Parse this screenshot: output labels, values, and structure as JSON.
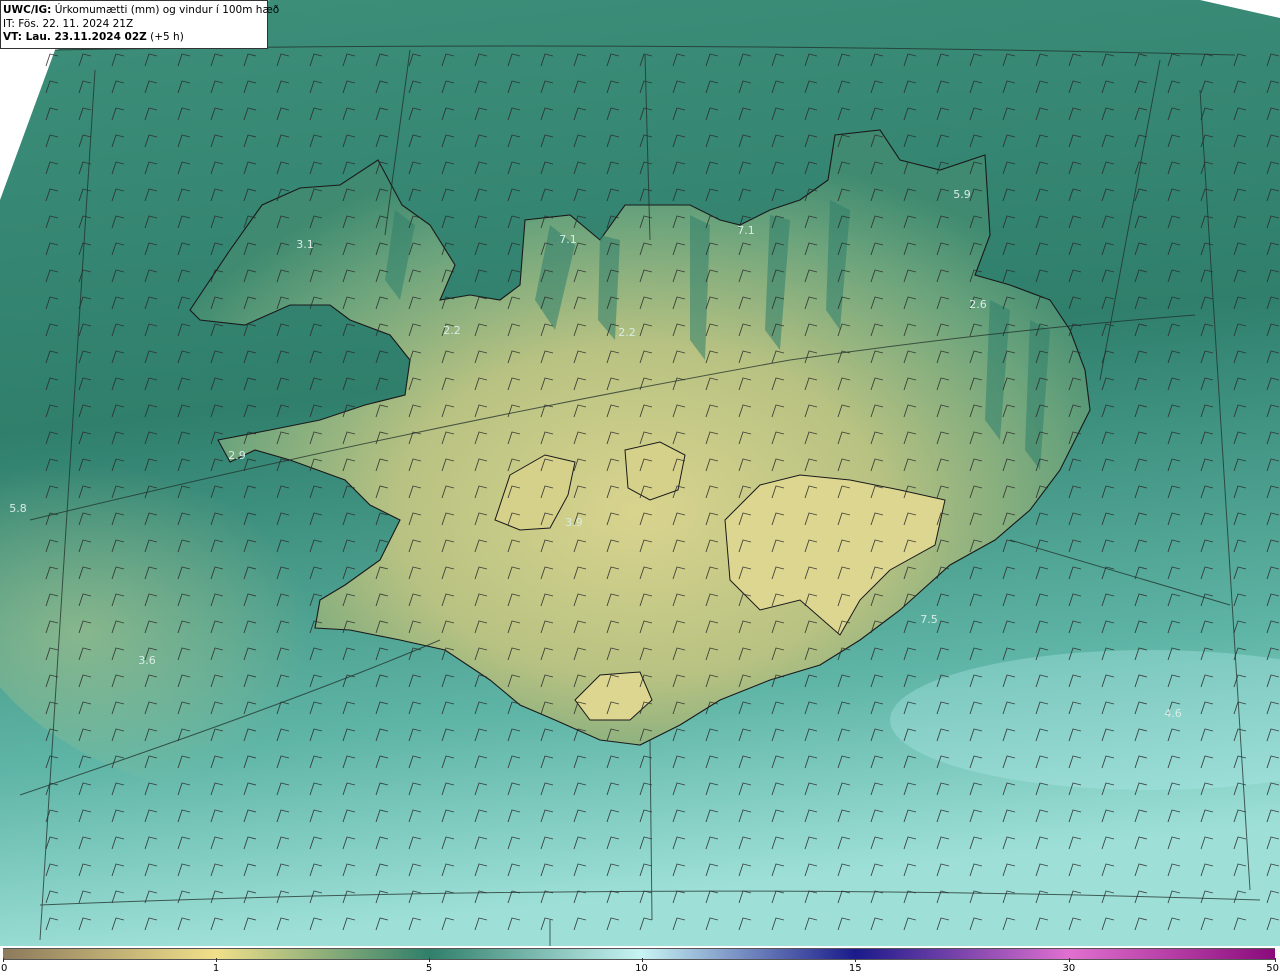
{
  "header": {
    "model": "UWC/IG:",
    "title": "Úrkomumætti (mm) og vindur í 100m hæð",
    "issue_time": "IT: Fös. 22. 11. 2024 21Z",
    "valid_prefix": "VT: Lau. 23.11.2024 02Z",
    "valid_suffix": "(+5 h)"
  },
  "map_labels": [
    {
      "text": "3.1"
    },
    {
      "text": "7.1"
    },
    {
      "text": "7.1"
    },
    {
      "text": "5.9"
    },
    {
      "text": "2.2"
    },
    {
      "text": "2.2"
    },
    {
      "text": "2.6"
    },
    {
      "text": "2.9"
    },
    {
      "text": "5.8"
    },
    {
      "text": "3.9"
    },
    {
      "text": "7.5"
    },
    {
      "text": "3.6"
    },
    {
      "text": "4.6"
    }
  ],
  "colorbar": {
    "ticks": [
      "0",
      "1",
      "5",
      "10",
      "15",
      "30",
      "50"
    ],
    "stops": [
      {
        "value": "0",
        "color": "#8c7a5c"
      },
      {
        "value": "1",
        "color": "#f0e08a"
      },
      {
        "value": "5",
        "color": "#2f7f6a"
      },
      {
        "value": "10",
        "color": "#c8f4f4"
      },
      {
        "value": "15",
        "color": "#1a1a8a"
      },
      {
        "value": "30",
        "color": "#e070d0"
      },
      {
        "value": "50",
        "color": "#8a0a7a"
      }
    ]
  },
  "colors": {
    "sea_deep": "#2a7e6c",
    "sea_light": "#8fd8d0",
    "land_low": "#6aa57e",
    "land_high": "#d8d68a",
    "coastline": "#1a1a1a"
  }
}
